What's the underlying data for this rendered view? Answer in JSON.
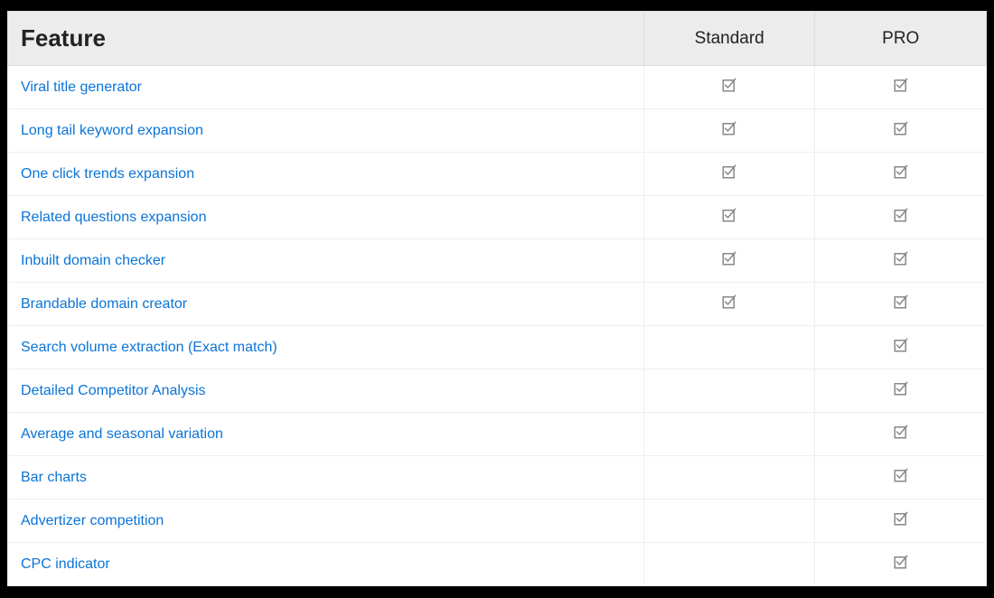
{
  "columns": {
    "feature": "Feature",
    "standard": "Standard",
    "pro": "PRO"
  },
  "features": [
    {
      "label": "Viral title generator",
      "standard": true,
      "pro": true
    },
    {
      "label": "Long tail keyword expansion",
      "standard": true,
      "pro": true
    },
    {
      "label": "One click trends expansion",
      "standard": true,
      "pro": true
    },
    {
      "label": "Related questions expansion",
      "standard": true,
      "pro": true
    },
    {
      "label": "Inbuilt domain checker",
      "standard": true,
      "pro": true
    },
    {
      "label": "Brandable domain creator",
      "standard": true,
      "pro": true
    },
    {
      "label": "Search volume extraction (Exact match)",
      "standard": false,
      "pro": true
    },
    {
      "label": "Detailed Competitor Analysis",
      "standard": false,
      "pro": true
    },
    {
      "label": "Average and seasonal variation",
      "standard": false,
      "pro": true
    },
    {
      "label": "Bar charts",
      "standard": false,
      "pro": true
    },
    {
      "label": "Advertizer competition",
      "standard": false,
      "pro": true
    },
    {
      "label": "CPC indicator",
      "standard": false,
      "pro": true
    }
  ],
  "icons": {
    "check": "check-icon"
  },
  "colors": {
    "link": "#0b74d6",
    "check": "#888",
    "header_bg": "#ececec",
    "border": "#eee"
  }
}
